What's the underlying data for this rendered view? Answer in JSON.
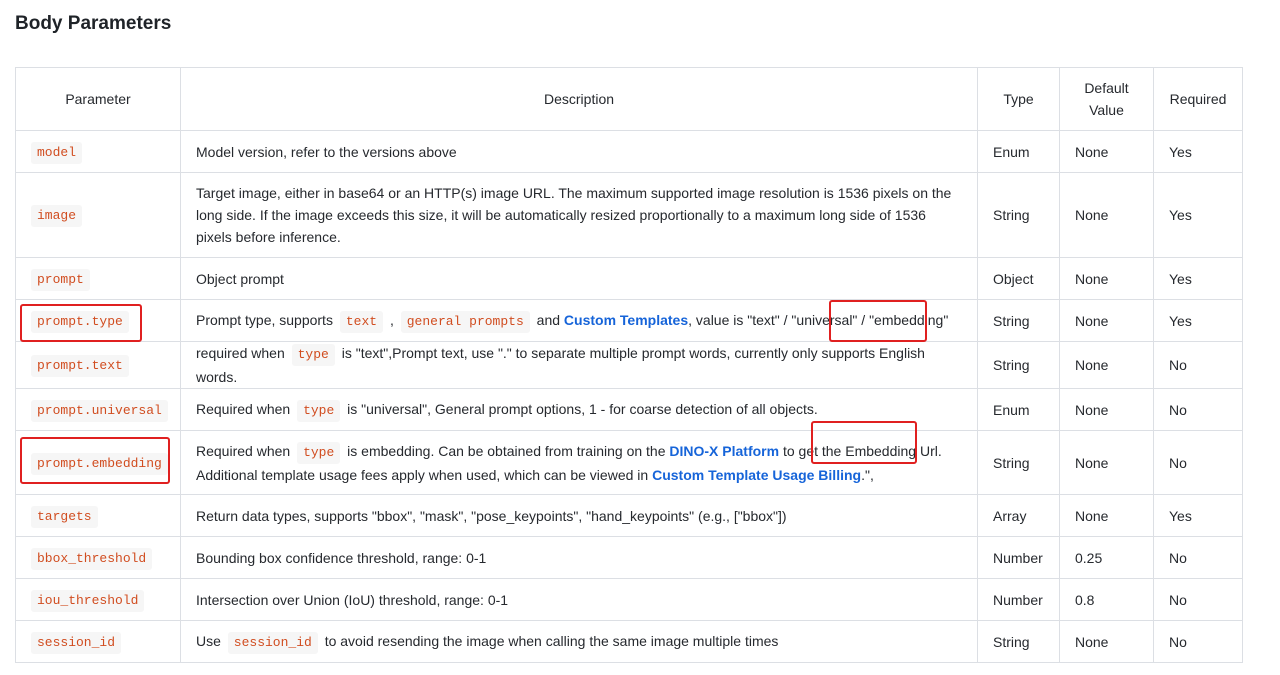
{
  "title": "Body Parameters",
  "headers": {
    "parameter": "Parameter",
    "description": "Description",
    "type": "Type",
    "default_line1": "Default",
    "default_line2": "Value",
    "required": "Required"
  },
  "rows": [
    {
      "param": "model",
      "desc": "Model version, refer to the versions above",
      "type": "Enum",
      "default": "None",
      "required": "Yes"
    },
    {
      "param": "image",
      "desc": "Target image, either in base64 or an HTTP(s) image URL. The maximum supported image resolution is 1536 pixels on the long side. If the image exceeds this size, it will be automatically resized proportionally to a maximum long side of 1536 pixels before inference.",
      "type": "String",
      "default": "None",
      "required": "Yes"
    },
    {
      "param": "prompt",
      "desc": "Object prompt",
      "type": "Object",
      "default": "None",
      "required": "Yes"
    },
    {
      "param": "prompt.type",
      "desc_a": "Prompt type, supports ",
      "code1": "text",
      "desc_b": " , ",
      "code2": "general prompts",
      "desc_c": " and ",
      "link": "Custom Templates",
      "desc_d": ", value is \"text\" / \"universal\" / \"embedding\"",
      "type": "String",
      "default": "None",
      "required": "Yes"
    },
    {
      "param": "prompt.text",
      "desc_a": "required when ",
      "code1": "type",
      "desc_b": " is \"text\",Prompt text, use \".\" to separate multiple prompt words, currently only supports English words.",
      "type": "String",
      "default": "None",
      "required": "No"
    },
    {
      "param": "prompt.universal",
      "desc_a": "Required when ",
      "code1": "type",
      "desc_b": " is \"universal\", General prompt options, 1 - for coarse detection of all objects.",
      "type": "Enum",
      "default": "None",
      "required": "No"
    },
    {
      "param": "prompt.embedding",
      "desc_a": "Required when ",
      "code1": "type",
      "desc_b": " is embedding. Can be obtained from training on the ",
      "link1": "DINO-X Platform",
      "desc_c": " to get the Embedding Url. Additional template usage fees apply when used, which can be viewed in ",
      "link2": "Custom Template Usage Billing",
      "desc_d": ".\",",
      "type": "String",
      "default": "None",
      "required": "No"
    },
    {
      "param": "targets",
      "desc": "Return data types, supports \"bbox\", \"mask\", \"pose_keypoints\", \"hand_keypoints\" (e.g., [\"bbox\"])",
      "type": "Array",
      "default": "None",
      "required": "Yes"
    },
    {
      "param": "bbox_threshold",
      "desc": "Bounding box confidence threshold, range: 0-1",
      "type": "Number",
      "default": "0.25",
      "required": "No"
    },
    {
      "param": "iou_threshold",
      "desc": "Intersection over Union (IoU) threshold, range: 0-1",
      "type": "Number",
      "default": "0.8",
      "required": "No"
    },
    {
      "param": "session_id",
      "desc_a": "Use ",
      "code1": "session_id",
      "desc_b": " to avoid resending the image when calling the same image multiple times",
      "type": "String",
      "default": "None",
      "required": "No"
    }
  ],
  "colors": {
    "code_text": "#d14d20",
    "link": "#1664d9",
    "highlight_box": "#e02020",
    "border": "#dcdfe4"
  }
}
